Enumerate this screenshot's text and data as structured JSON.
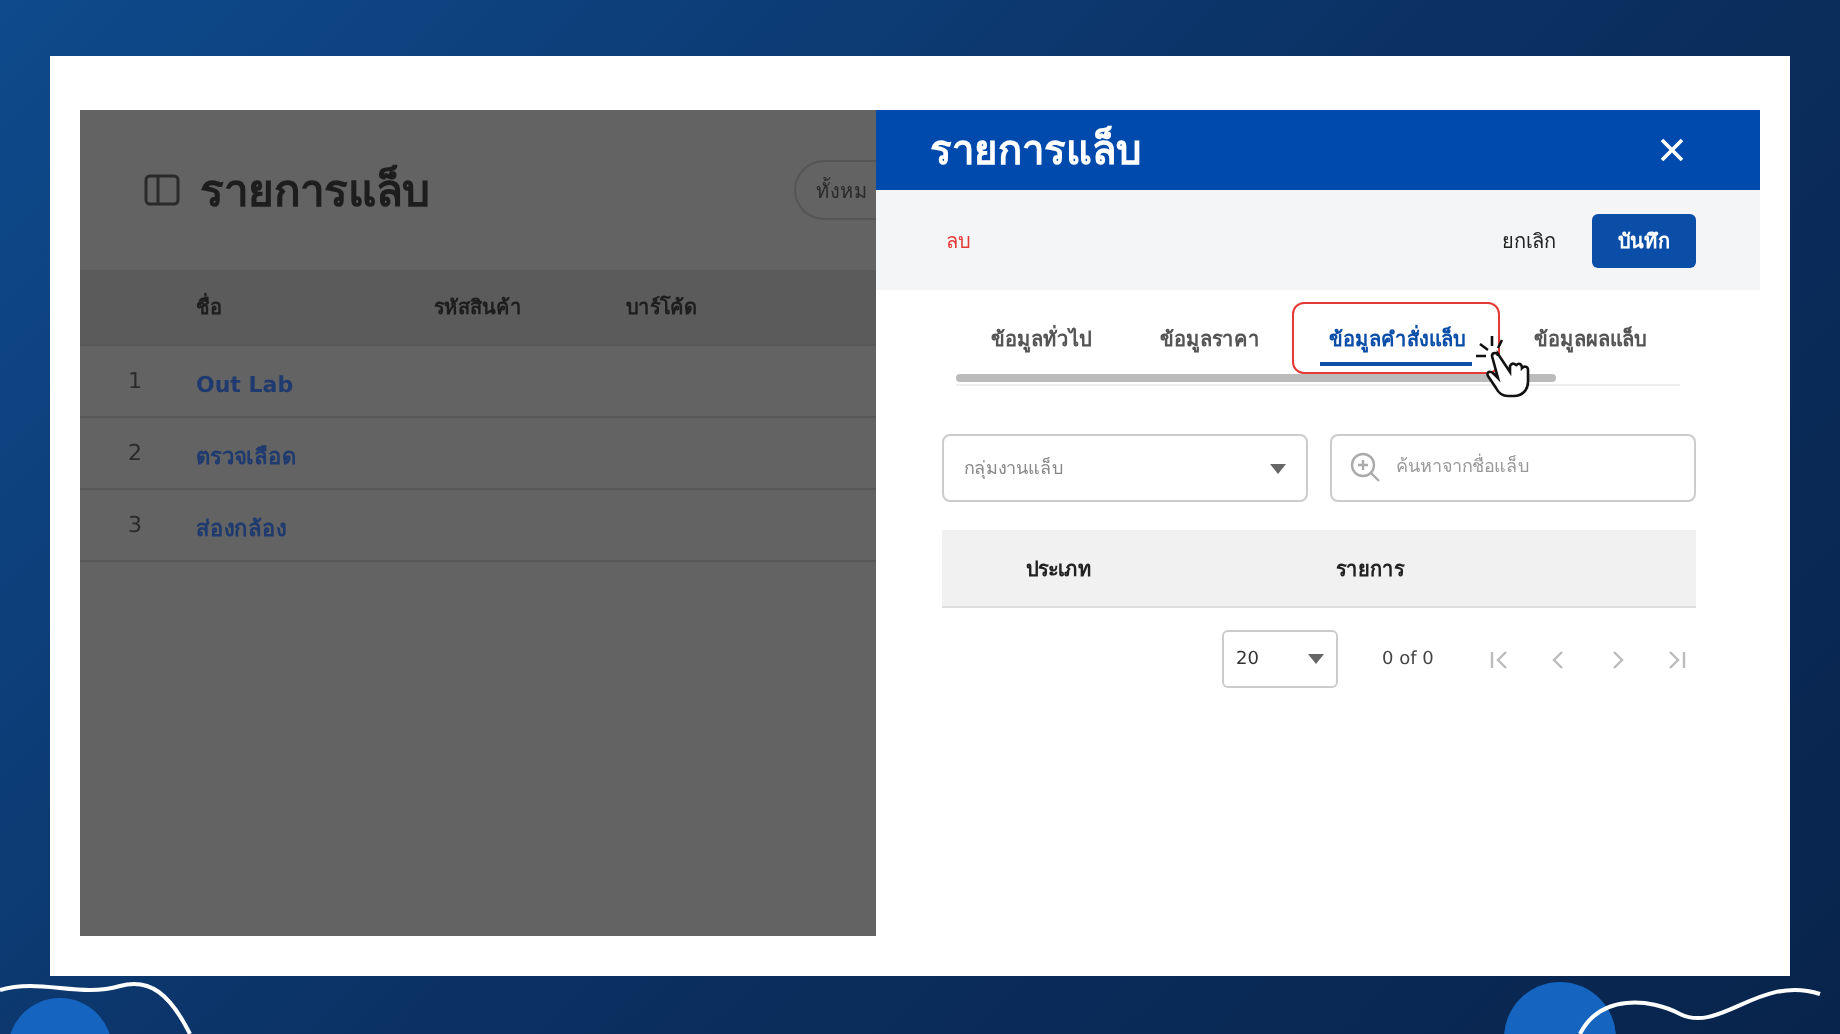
{
  "page": {
    "title": "รายการแล็บ",
    "filter_button": "ทั้งหม",
    "table": {
      "columns": [
        "ชื่อ",
        "รหัสสินค้า",
        "บาร์โค้ด"
      ],
      "rows": [
        {
          "index": "1",
          "name": "Out Lab"
        },
        {
          "index": "2",
          "name": "ตรวจเลือด"
        },
        {
          "index": "3",
          "name": "ส่องกล้อง"
        }
      ]
    }
  },
  "drawer": {
    "title": "รายการแล็บ",
    "delete": "ลบ",
    "cancel": "ยกเลิก",
    "save": "บันทึก",
    "tabs": [
      {
        "label": "ข้อมูลทั่วไป",
        "selected": false,
        "highlighted": false
      },
      {
        "label": "ข้อมูลราคา",
        "selected": false,
        "highlighted": false
      },
      {
        "label": "ข้อมูลคำสั่งแล็บ",
        "selected": true,
        "highlighted": true
      },
      {
        "label": "ข้อมูลผลแล็บ",
        "selected": false,
        "highlighted": false
      }
    ],
    "group_select": {
      "placeholder": "กลุ่มงานแล็บ"
    },
    "search": {
      "placeholder": "ค้นหาจากชื่อแล็บ"
    },
    "table": {
      "columns": [
        "ประเภท",
        "รายการ"
      ]
    },
    "pagination": {
      "page_size": "20",
      "range": "0 of 0"
    }
  }
}
